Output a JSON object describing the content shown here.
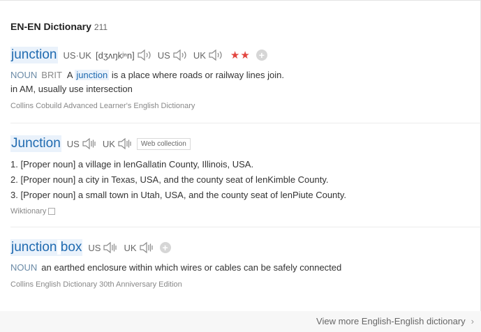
{
  "section": {
    "title": "EN-EN Dictionary",
    "count": "211"
  },
  "entries": [
    {
      "headword": "junction",
      "pron_us_uk": "US·UK",
      "ipa": "[dʒʌŋkʲⁿn]",
      "us": "US",
      "uk": "UK",
      "stars": "★★",
      "pos": "NOUN",
      "region": "BRIT",
      "def_prefix": "A",
      "def_highlight": "junction",
      "def_suffix": "is a place where roads or railway lines join.",
      "note": "in AM, usually use intersection",
      "source": "Collins Cobuild Advanced Learner's English Dictionary"
    },
    {
      "headword": "Junction",
      "us": "US",
      "uk": "UK",
      "tag": "Web collection",
      "defs": [
        "1. [Proper noun] a village in lenGallatin County, Illinois, USA.",
        "2. [Proper noun] a city in Texas, USA, and the county seat of lenKimble County.",
        "3. [Proper noun] a small town in Utah, USA, and the county seat of lenPiute County."
      ],
      "source": "Wiktionary"
    },
    {
      "headword_part1": "junction",
      "headword_part2": "box",
      "us": "US",
      "uk": "UK",
      "pos": "NOUN",
      "def": "an earthed enclosure within which wires or cables can be safely connected",
      "source": "Collins English Dictionary 30th Anniversary Edition"
    }
  ],
  "footer": {
    "view_more": "View more English-English dictionary",
    "chevron": "›"
  },
  "icons": {
    "speaker": "speaker-icon",
    "plus": "add-icon",
    "external": "external-link-icon"
  },
  "colors": {
    "accent": "#1f6ab0",
    "highlight_bg": "#eaf2fb",
    "stars": "#e2453f"
  }
}
